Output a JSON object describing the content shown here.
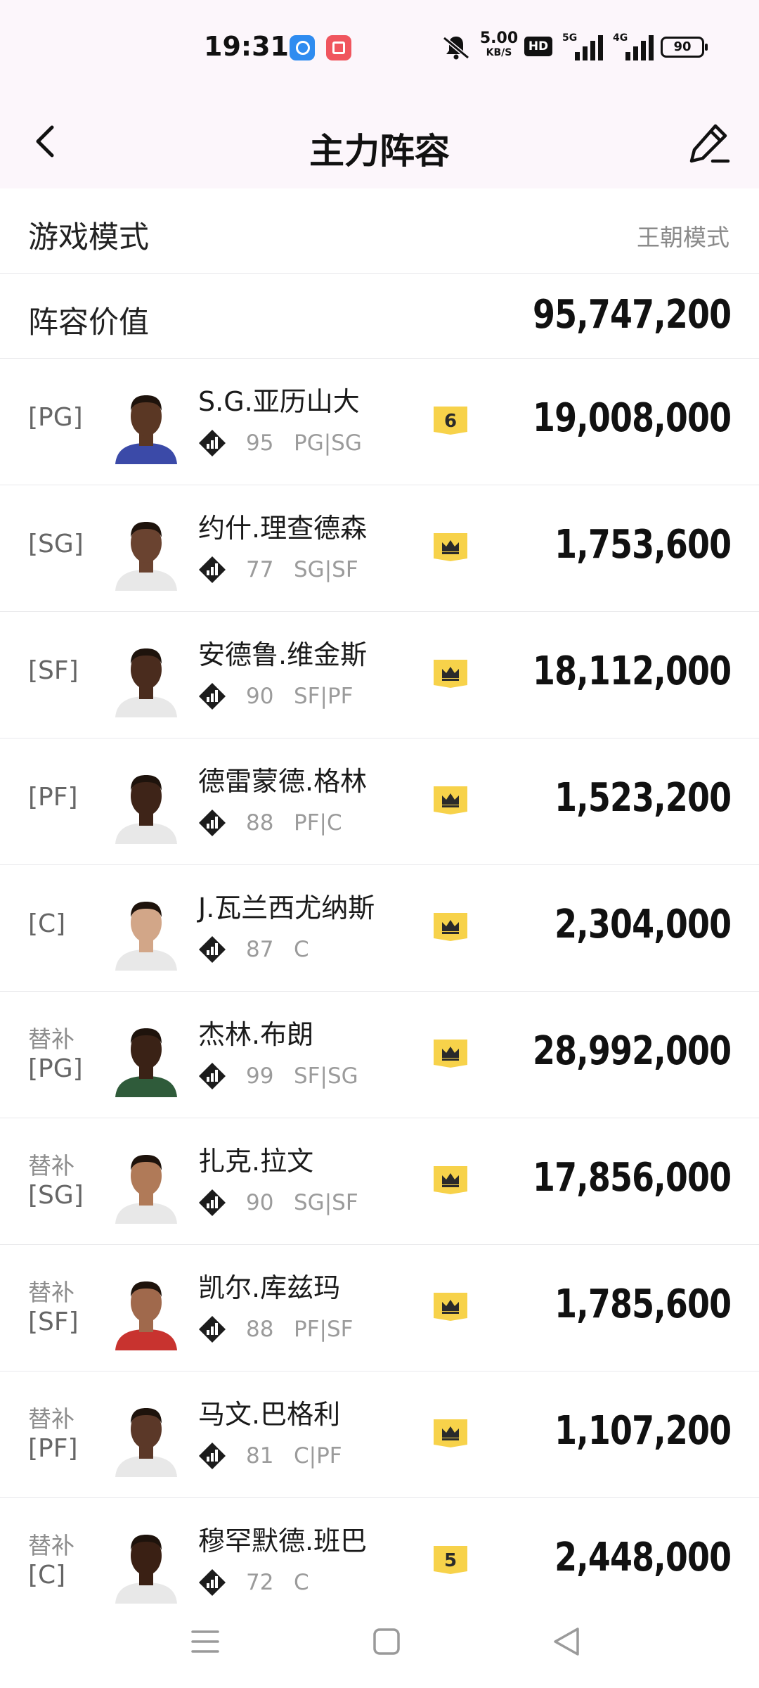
{
  "status_bar": {
    "time": "19:31",
    "speed_value": "5.00",
    "speed_unit": "KB/S",
    "hd_label": "HD",
    "signal1_label": "5G",
    "signal2_label": "4G",
    "battery": "90",
    "icons": [
      "app-icon-blue",
      "app-icon-red",
      "mute-icon"
    ]
  },
  "header": {
    "title": "主力阵容",
    "back_icon": "chevron-left-icon",
    "edit_icon": "edit-icon"
  },
  "settings": {
    "mode_label": "游戏模式",
    "mode_value": "王朝模式",
    "value_label": "阵容价值",
    "value_total": "95,747,200"
  },
  "players": [
    {
      "slot_sub": "",
      "slot": "[PG]",
      "name": "S.G.亚历山大",
      "rating": "95",
      "positions": "PG|SG",
      "badge": "number",
      "badge_text": "6",
      "price": "19,008,000",
      "skin": "#5a3724",
      "jersey": "#3b4aa8"
    },
    {
      "slot_sub": "",
      "slot": "[SG]",
      "name": "约什.理查德森",
      "rating": "77",
      "positions": "SG|SF",
      "badge": "crown",
      "badge_text": "",
      "price": "1,753,600",
      "skin": "#6a4330",
      "jersey": "#e8e8e8"
    },
    {
      "slot_sub": "",
      "slot": "[SF]",
      "name": "安德鲁.维金斯",
      "rating": "90",
      "positions": "SF|PF",
      "badge": "crown",
      "badge_text": "",
      "price": "18,112,000",
      "skin": "#4a2c1e",
      "jersey": "#e8e8e8"
    },
    {
      "slot_sub": "",
      "slot": "[PF]",
      "name": "德雷蒙德.格林",
      "rating": "88",
      "positions": "PF|C",
      "badge": "crown",
      "badge_text": "",
      "price": "1,523,200",
      "skin": "#3e2418",
      "jersey": "#e8e8e8"
    },
    {
      "slot_sub": "",
      "slot": "[C]",
      "name": "J.瓦兰西尤纳斯",
      "rating": "87",
      "positions": "C",
      "badge": "crown",
      "badge_text": "",
      "price": "2,304,000",
      "skin": "#d2a688",
      "jersey": "#e8e8e8"
    },
    {
      "slot_sub": "替补",
      "slot": "[PG]",
      "name": "杰林.布朗",
      "rating": "99",
      "positions": "SF|SG",
      "badge": "crown",
      "badge_text": "",
      "price": "28,992,000",
      "skin": "#3a2216",
      "jersey": "#2f5b3a"
    },
    {
      "slot_sub": "替补",
      "slot": "[SG]",
      "name": "扎克.拉文",
      "rating": "90",
      "positions": "SG|SF",
      "badge": "crown",
      "badge_text": "",
      "price": "17,856,000",
      "skin": "#b07a58",
      "jersey": "#e8e8e8"
    },
    {
      "slot_sub": "替补",
      "slot": "[SF]",
      "name": "凯尔.库兹玛",
      "rating": "88",
      "positions": "PF|SF",
      "badge": "crown",
      "badge_text": "",
      "price": "1,785,600",
      "skin": "#a0694c",
      "jersey": "#c8332f"
    },
    {
      "slot_sub": "替补",
      "slot": "[PF]",
      "name": "马文.巴格利",
      "rating": "81",
      "positions": "C|PF",
      "badge": "crown",
      "badge_text": "",
      "price": "1,107,200",
      "skin": "#5b3828",
      "jersey": "#e8e8e8"
    },
    {
      "slot_sub": "替补",
      "slot": "[C]",
      "name": "穆罕默德.班巴",
      "rating": "72",
      "positions": "C",
      "badge": "number",
      "badge_text": "5",
      "price": "2,448,000",
      "skin": "#3a2014",
      "jersey": "#e8e8e8"
    }
  ],
  "nav_bar": {
    "icons": [
      "menu-icon",
      "home-icon",
      "back-triangle-icon"
    ]
  },
  "colors": {
    "badge_gold": "#f7d24a",
    "header_bg": "#fcf6fb",
    "muted_text": "#9b9b9b"
  }
}
